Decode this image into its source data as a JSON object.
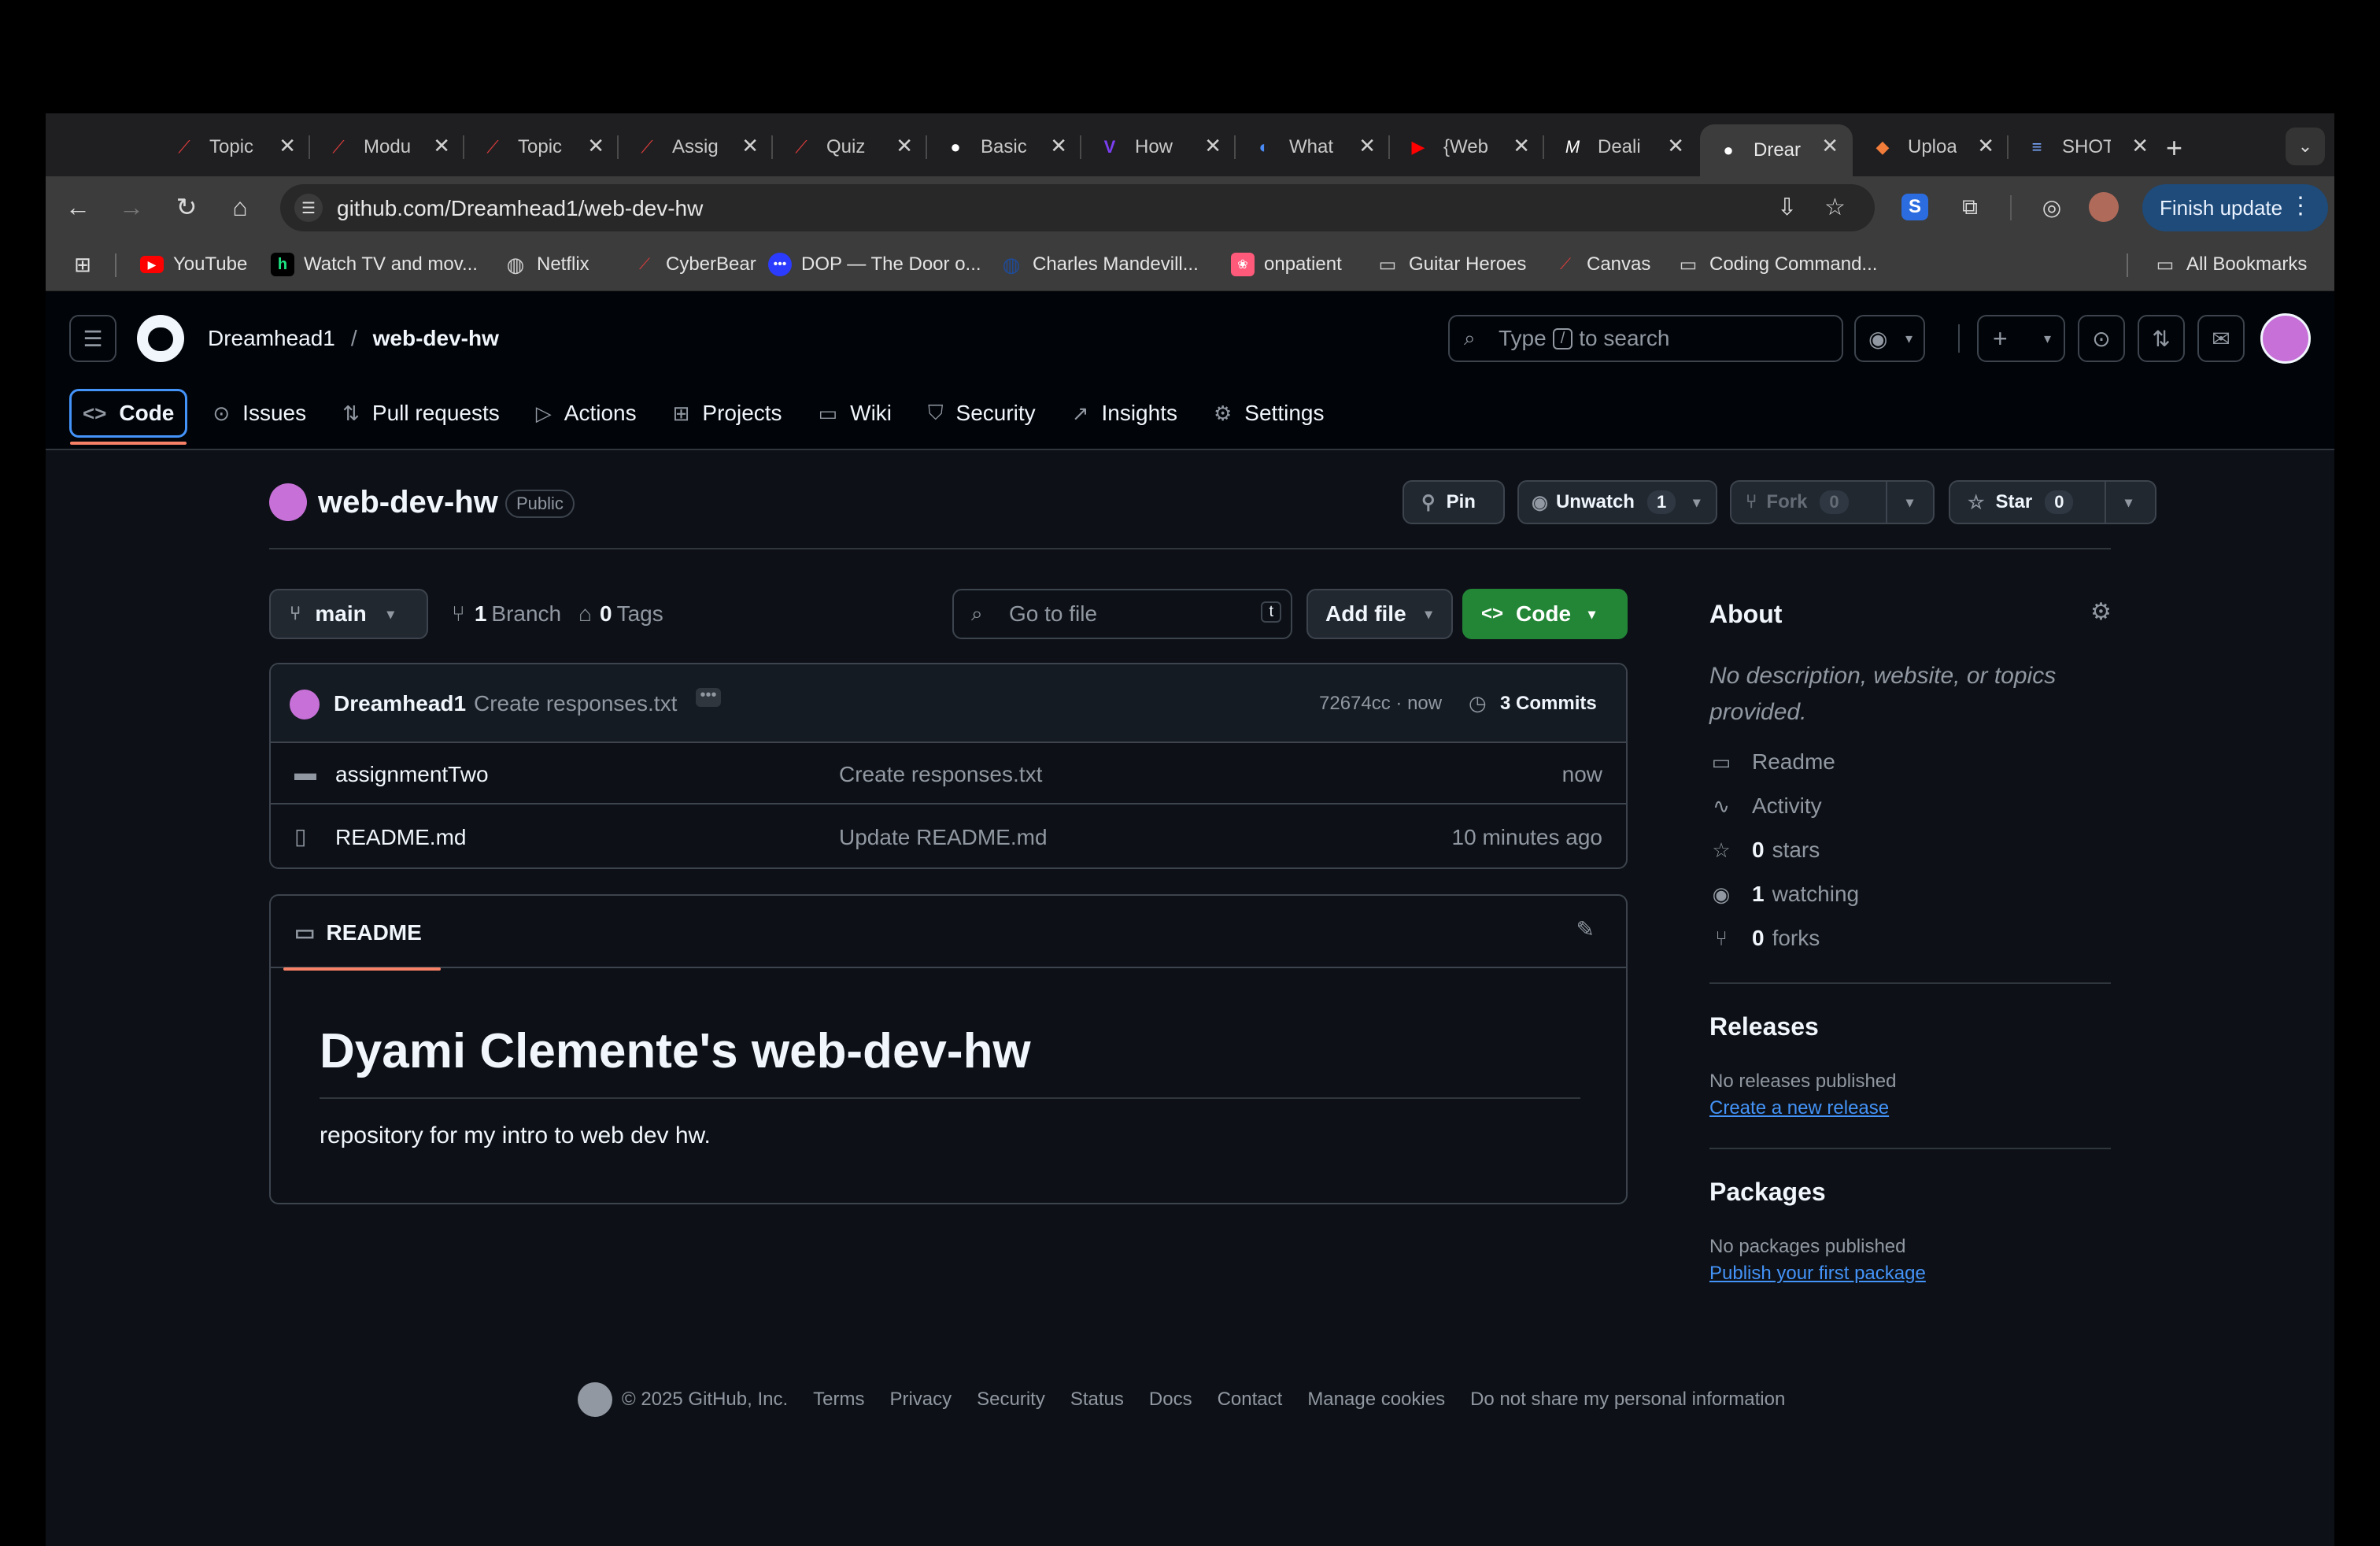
{
  "browser": {
    "tabs": [
      {
        "label": "Topic",
        "icon": "canvas-icon",
        "color": "#e03c3c"
      },
      {
        "label": "Modu",
        "icon": "canvas-icon",
        "color": "#e03c3c"
      },
      {
        "label": "Topic",
        "icon": "canvas-icon",
        "color": "#e03c3c"
      },
      {
        "label": "Assig",
        "icon": "canvas-icon",
        "color": "#e03c3c"
      },
      {
        "label": "Quiz",
        "icon": "canvas-icon",
        "color": "#e03c3c"
      },
      {
        "label": "Basic",
        "icon": "github-icon",
        "color": "#ffffff"
      },
      {
        "label": "How",
        "icon": "v-logo-icon",
        "color": "#7b3ff2"
      },
      {
        "label": "What",
        "icon": "c-logo-icon",
        "color": "#4a8af4"
      },
      {
        "label": "{Web",
        "icon": "youtube-icon",
        "color": "#ff0000"
      },
      {
        "label": "Deali",
        "icon": "medium-icon",
        "color": "#ffffff"
      },
      {
        "label": "Drear",
        "icon": "github-icon",
        "color": "#ffffff",
        "active": true
      },
      {
        "label": "Uploa",
        "icon": "layers-icon",
        "color": "#f27d3b"
      },
      {
        "label": "SHOT",
        "icon": "list-icon",
        "color": "#7aa7ff"
      }
    ],
    "new_tab": "+",
    "url": "github.com/Dreamhead1/web-dev-hw",
    "finish_update": "Finish update",
    "bookmarks": [
      {
        "label": "YouTube",
        "icon": "youtube-icon",
        "color": "#ff0000"
      },
      {
        "label": "Watch TV and mov...",
        "icon": "hulu-icon",
        "color": "#1ce783"
      },
      {
        "label": "Netflix",
        "icon": "globe-icon",
        "color": "#cccccc"
      },
      {
        "label": "CyberBear",
        "icon": "canvas-icon",
        "color": "#e03c3c"
      },
      {
        "label": "DOP — The Door o...",
        "icon": "dots-icon",
        "color": "#2b3bff"
      },
      {
        "label": "Charles Mandevill...",
        "icon": "globe-icon",
        "color": "#1e4b9a"
      },
      {
        "label": "onpatient",
        "icon": "onpatient-icon",
        "color": "#ff5a7a"
      },
      {
        "label": "Guitar Heroes",
        "icon": "folder-icon",
        "color": "#cccccc"
      },
      {
        "label": "Canvas",
        "icon": "canvas-icon",
        "color": "#e03c3c"
      },
      {
        "label": "Coding Command...",
        "icon": "folder-icon",
        "color": "#cccccc"
      }
    ],
    "all_bookmarks": "All Bookmarks"
  },
  "github": {
    "owner": "Dreamhead1",
    "slash": "/",
    "repo": "web-dev-hw",
    "search_pre": "Type",
    "search_key": "/",
    "search_post": "to search",
    "nav": [
      "Code",
      "Issues",
      "Pull requests",
      "Actions",
      "Projects",
      "Wiki",
      "Security",
      "Insights",
      "Settings"
    ]
  },
  "repo": {
    "name": "web-dev-hw",
    "visibility": "Public",
    "pin": "Pin",
    "unwatch": "Unwatch",
    "watch_count": "1",
    "fork": "Fork",
    "fork_count": "0",
    "star": "Star",
    "star_count": "0"
  },
  "files": {
    "branch": "main",
    "branch_count": "1",
    "branch_label": "Branch",
    "tag_count": "0",
    "tag_label": "Tags",
    "go_to_file": "Go to file",
    "go_key": "t",
    "add_file": "Add file",
    "code": "Code",
    "commit_author": "Dreamhead1",
    "commit_message": "Create responses.txt",
    "commit_hash": "72674cc · now",
    "commits_count": "3",
    "commits_label": "Commits",
    "rows": [
      {
        "name": "assignmentTwo",
        "message": "Create responses.txt",
        "time": "now",
        "type": "folder"
      },
      {
        "name": "README.md",
        "message": "Update README.md",
        "time": "10 minutes ago",
        "type": "file"
      }
    ]
  },
  "readme": {
    "tab": "README",
    "heading": "Dyami Clemente's web-dev-hw",
    "body": "repository for my intro to web dev hw."
  },
  "about": {
    "title": "About",
    "description": "No description, website, or topics provided.",
    "readme": "Readme",
    "activity": "Activity",
    "stars_count": "0",
    "stars_label": "stars",
    "watching_count": "1",
    "watching_label": "watching",
    "forks_count": "0",
    "forks_label": "forks",
    "releases_title": "Releases",
    "releases_none": "No releases published",
    "releases_link": "Create a new release",
    "packages_title": "Packages",
    "packages_none": "No packages published",
    "packages_link": "Publish your first package"
  },
  "footer": {
    "copyright": "© 2025 GitHub, Inc.",
    "links": [
      "Terms",
      "Privacy",
      "Security",
      "Status",
      "Docs",
      "Contact",
      "Manage cookies",
      "Do not share my personal information"
    ]
  }
}
